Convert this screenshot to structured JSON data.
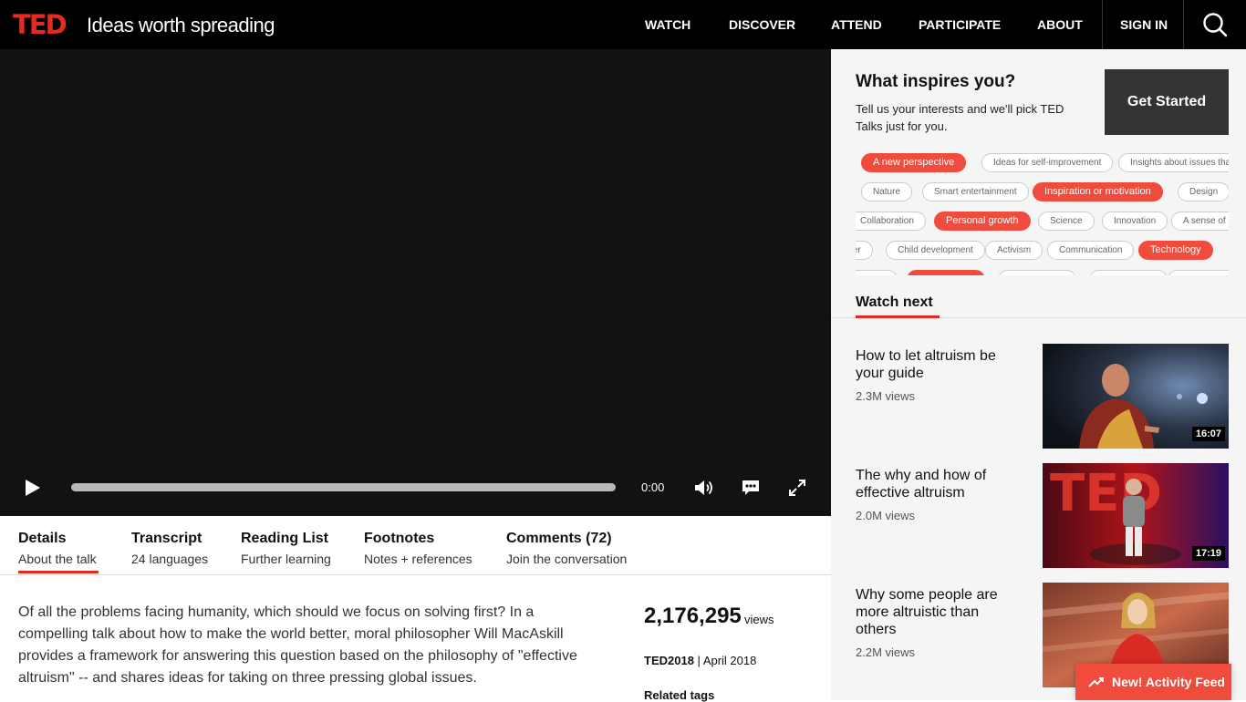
{
  "header": {
    "logo": "TED",
    "tagline": "Ideas worth spreading",
    "nav": [
      "WATCH",
      "DISCOVER",
      "ATTEND",
      "PARTICIPATE",
      "ABOUT"
    ],
    "signin": "SIGN IN"
  },
  "player": {
    "time": "0:00",
    "progress": 0
  },
  "tabs": [
    {
      "title": "Details",
      "sub": "About the talk"
    },
    {
      "title": "Transcript",
      "sub": "24 languages"
    },
    {
      "title": "Reading List",
      "sub": "Further learning"
    },
    {
      "title": "Footnotes",
      "sub": "Notes + references"
    },
    {
      "title": "Comments (72)",
      "sub": "Join the conversation"
    }
  ],
  "talk": {
    "description": "Of all the problems facing humanity, which should we focus on solving first? In a compelling talk about how to make the world better, moral philosopher Will MacAskill provides a framework for answering this question based on the philosophy of \"effective altruism\" -- and shares ideas for taking on three pressing global issues.",
    "views": "2,176,295",
    "views_label": "views",
    "event": "TED2018",
    "date": "April 2018",
    "related_tags": "Related tags"
  },
  "inspire": {
    "title": "What inspires you?",
    "subtitle": "Tell us your interests and we'll pick TED Talks just for you.",
    "button": "Get Started",
    "tags": {
      "row1": [
        "A new perspective",
        "Ideas for self-improvement",
        "Insights about issues tha"
      ],
      "row2": [
        "Nature",
        "Smart entertainment",
        "Inspiration or motivation",
        "Design"
      ],
      "row3": [
        "Collaboration",
        "Personal growth",
        "Science",
        "Innovation",
        "A sense of h"
      ],
      "row4": [
        "cter",
        "Child development",
        "Activism",
        "Communication",
        "Technology"
      ]
    }
  },
  "watch_next": {
    "title": "Watch next",
    "items": [
      {
        "title": "How to let altruism be your guide",
        "views": "2.3M views",
        "duration": "16:07"
      },
      {
        "title": "The why and how of effective altruism",
        "views": "2.0M views",
        "duration": "17:19"
      },
      {
        "title": "Why some people are more altruistic than others",
        "views": "2.2M views",
        "duration": ""
      }
    ]
  },
  "activity_feed": "New! Activity Feed",
  "colors": {
    "accent": "#e62b1e",
    "tag_selected": "#f04c3e",
    "header_bg": "#000000",
    "video_bg": "#121212"
  }
}
